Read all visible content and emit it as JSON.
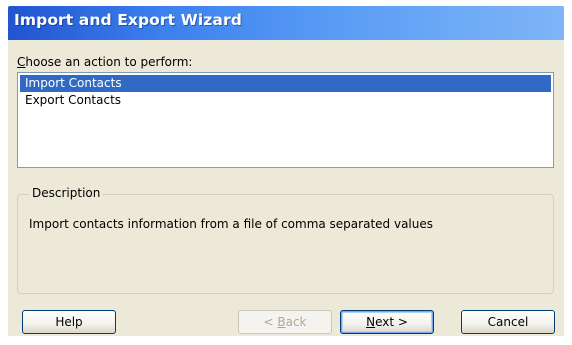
{
  "window": {
    "title": "Import and Export Wizard"
  },
  "prompt": {
    "mnemonic": "C",
    "rest": "hoose an action to perform:"
  },
  "actions": [
    {
      "label": "Import Contacts",
      "selected": true
    },
    {
      "label": "Export Contacts",
      "selected": false
    }
  ],
  "description": {
    "legend": "Description",
    "text": "Import contacts information from a file of comma separated values"
  },
  "buttons": {
    "help": "Help",
    "back": {
      "prefix": "< ",
      "mnemonic": "B",
      "rest": "ack",
      "enabled": false
    },
    "next": {
      "mnemonic": "N",
      "rest": "ext >",
      "enabled": true
    },
    "cancel": "Cancel"
  },
  "colors": {
    "selection": "#316ac5",
    "dialog_bg": "#ece9d8",
    "title_bar": "#3d80ee"
  }
}
